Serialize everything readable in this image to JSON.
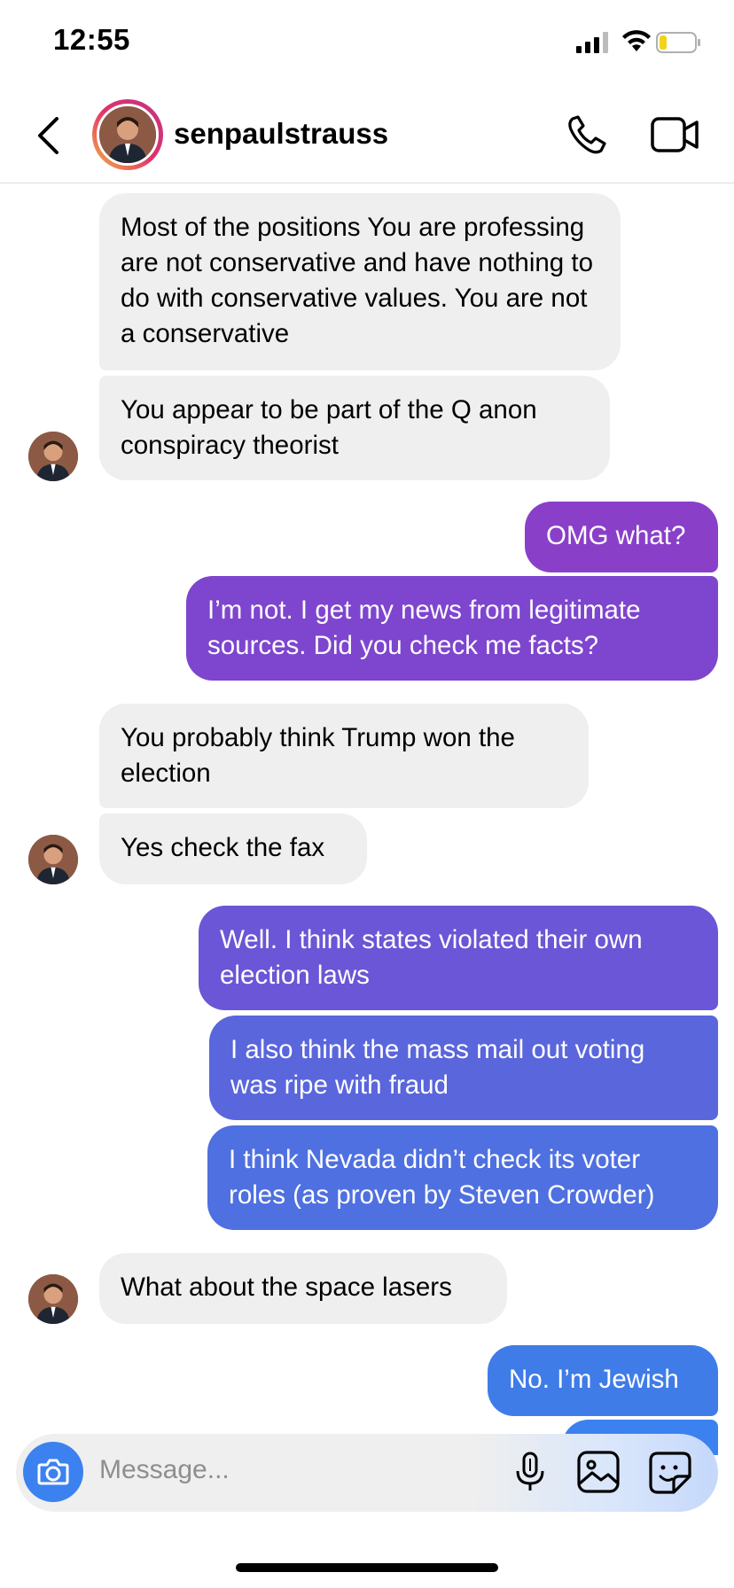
{
  "status_bar": {
    "time": "12:55"
  },
  "header": {
    "username": "senpaulstrauss"
  },
  "messages": [
    {
      "text": "Most of the positions You are professing are not conservative and have nothing to do with conservative values. You are not a conservative"
    },
    {
      "text": "You appear to be part of the Q anon conspiracy theorist"
    },
    {
      "text": "OMG what?"
    },
    {
      "text": "I’m not. I get my news from legitimate sources. Did you check me facts?"
    },
    {
      "text": "You probably think Trump won the election"
    },
    {
      "text": "Yes check the fax"
    },
    {
      "text": "Well. I think states violated their own election laws"
    },
    {
      "text": "I also think the mass mail out voting was ripe with fraud"
    },
    {
      "text": "I think Nevada didn’t check its voter roles (as proven by Steven Crowder)"
    },
    {
      "text": "What about the space lasers"
    },
    {
      "text": "No. I’m Jewish"
    }
  ],
  "composer": {
    "placeholder": "Message..."
  },
  "colors": {
    "incoming": "#efefef",
    "outgoing_purple": "#8a3fc9",
    "outgoing_blue": "#3b82f0",
    "story_ring": "#e1306c"
  },
  "icons": [
    "back-icon",
    "phone-icon",
    "video-icon",
    "camera-icon",
    "mic-icon",
    "gallery-icon",
    "sticker-icon",
    "signal-icon",
    "wifi-icon",
    "battery-icon"
  ]
}
